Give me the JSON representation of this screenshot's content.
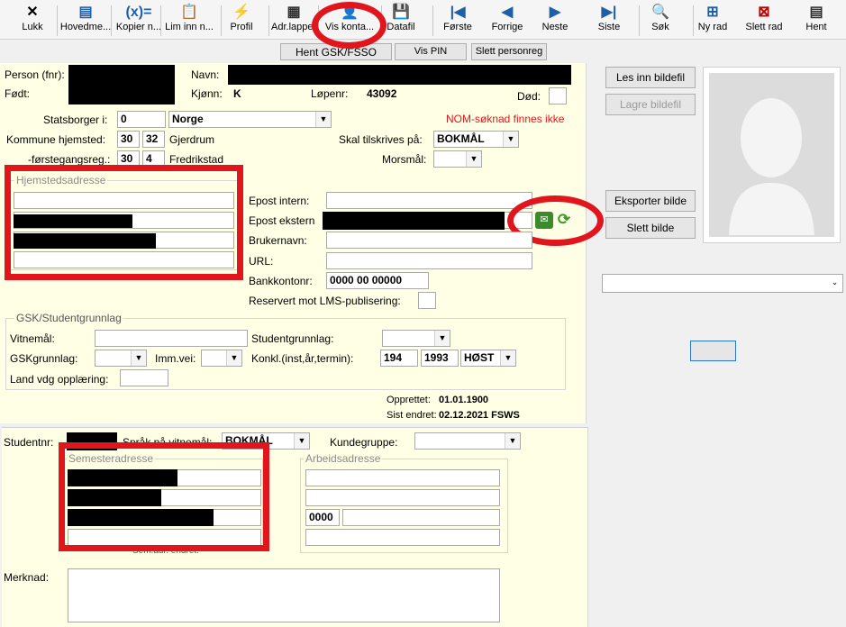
{
  "toolbar": {
    "items": [
      {
        "label": "Lukk",
        "icon": "close-icon",
        "glyph": "✕",
        "color": "#000000"
      },
      {
        "label": "Hovedme...",
        "icon": "main-menu-icon",
        "glyph": "▤",
        "color": "#1f5fa8"
      },
      {
        "label": "Kopier n...",
        "icon": "copy-number-icon",
        "glyph": "(x)=",
        "color": "#1f5fa8"
      },
      {
        "label": "Lim inn n...",
        "icon": "paste-number-icon",
        "glyph": "📋",
        "color": "#d8a400"
      },
      {
        "label": "Profil",
        "icon": "profile-lightning-icon",
        "glyph": "⚡",
        "color": "#e7b100"
      },
      {
        "label": "Adr.lapper",
        "icon": "address-labels-icon",
        "glyph": "▦",
        "color": "#303030"
      },
      {
        "label": "Vis konta...",
        "icon": "show-contact-icon",
        "glyph": "👤",
        "color": "#d8a400"
      },
      {
        "label": "Datafil",
        "icon": "save-datafile-icon",
        "glyph": "💾",
        "color": "#1f5fa8"
      },
      {
        "label": "Første",
        "icon": "first-record-icon",
        "glyph": "|◀",
        "color": "#1f5fa8"
      },
      {
        "label": "Forrige",
        "icon": "previous-record-icon",
        "glyph": "◀",
        "color": "#1f5fa8"
      },
      {
        "label": "Neste",
        "icon": "next-record-icon",
        "glyph": "▶",
        "color": "#1f5fa8"
      },
      {
        "label": "Siste",
        "icon": "last-record-icon",
        "glyph": "▶|",
        "color": "#1f5fa8"
      },
      {
        "label": "Søk",
        "icon": "search-icon",
        "glyph": "🔍",
        "color": "#1f5fa8"
      },
      {
        "label": "Ny rad",
        "icon": "new-row-icon",
        "glyph": "⊞",
        "color": "#1f5fa8"
      },
      {
        "label": "Slett rad",
        "icon": "delete-row-icon",
        "glyph": "⊠",
        "color": "#c00000"
      },
      {
        "label": "Hent",
        "icon": "fetch-icon",
        "glyph": "▤",
        "color": "#303030"
      }
    ]
  },
  "top_buttons": {
    "hent": "Hent GSK/FSSO",
    "vis_pin": "Vis PIN",
    "slett": "Slett personreg"
  },
  "person": {
    "fnr_label": "Person (fnr):",
    "navn_label": "Navn:",
    "fodt_label": "Født:",
    "kjonn_label": "Kjønn:",
    "kjonn_value": "K",
    "lopenr_label": "Løpenr:",
    "lopenr_value": "43092",
    "dod_label": "Død:",
    "statsborger_label": "Statsborger i:",
    "statsborger_code": "0",
    "statsborger_name": "Norge",
    "nom_notice": "NOM-søknad finnes ikke",
    "kommune_label": "Kommune hjemsted:",
    "kommune_code1": "30",
    "kommune_code2": "32",
    "kommune_name": "Gjerdrum",
    "skal_label": "Skal tilskrives på:",
    "skal_value": "BOKMÅL",
    "forstegang_label": "-førstegangsreg.:",
    "forstegang_code1": "30",
    "forstegang_code2": "4",
    "forstegang_name": "Fredrikstad",
    "morsmal_label": "Morsmål:",
    "hjemsted_title": "Hjemstedsadresse",
    "epost_intern_label": "Epost intern:",
    "epost_ekstern_label": "Epost ekstern",
    "brukernavn_label": "Brukernavn:",
    "url_label": "URL:",
    "bankkonto_label": "Bankkontonr:",
    "bankkonto_value": "0000 00 00000",
    "reservert_label": "Reservert mot LMS-publisering:"
  },
  "gsk": {
    "title": "GSK/Studentgrunnlag",
    "vitnemal_label": "Vitnemål:",
    "studentgrunnlag_label": "Studentgrunnlag:",
    "gskgrunnlag_label": "GSKgrunnlag:",
    "immvei_label": "Imm.vei:",
    "konkl_label": "Konkl.(inst,år,termin):",
    "konkl_inst": "194",
    "konkl_ar": "1993",
    "konkl_termin": "HØST",
    "land_label": "Land vdg opplæring:",
    "opprettet_label": "Opprettet:",
    "opprettet_value": "01.01.1900",
    "endret_label": "Sist endret:",
    "endret_value": "02.12.2021  FSWS"
  },
  "student": {
    "studentnr_label": "Studentnr:",
    "sprak_label": "Språk på vitnemål:",
    "sprak_value": "BOKMÅL",
    "kundegruppe_label": "Kundegruppe:",
    "semester_title": "Semesteradresse",
    "arbeid_title": "Arbeidsadresse",
    "arbeid_postnr": "0000",
    "semadr_label": "Sem.adr. endret:",
    "merknad_label": "Merknad:"
  },
  "photo": {
    "les_inn": "Les inn bildefil",
    "lagre": "Lagre bildefil",
    "eksporter": "Eksporter bilde",
    "slett": "Slett bilde"
  },
  "colors": {
    "panel": "#ffffe6",
    "annotation": "#e0161c",
    "window": "#f0f0f0"
  }
}
